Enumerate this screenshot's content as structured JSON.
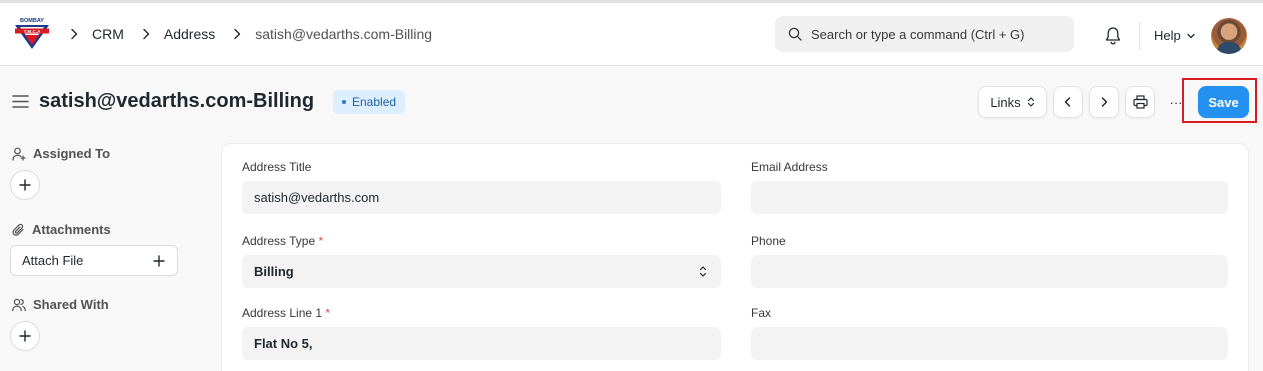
{
  "navbar": {
    "logo_text_top": "BOMBAY",
    "logo_text_bottom": "Y.M.C.A",
    "breadcrumbs": [
      "CRM",
      "Address",
      "satish@vedarths.com-Billing"
    ],
    "search_placeholder": "Search or type a command (Ctrl + G)",
    "help_label": "Help"
  },
  "header": {
    "title": "satish@vedarths.com-Billing",
    "status": "Enabled",
    "links_label": "Links",
    "more_label": "···",
    "save_label": "Save"
  },
  "sidebar": {
    "assigned_to": "Assigned To",
    "attachments": "Attachments",
    "attach_file": "Attach File",
    "shared_with": "Shared With"
  },
  "form": {
    "address_title": {
      "label": "Address Title",
      "value": "satish@vedarths.com"
    },
    "email_address": {
      "label": "Email Address",
      "value": ""
    },
    "address_type": {
      "label": "Address Type",
      "required": "*",
      "value": "Billing"
    },
    "phone": {
      "label": "Phone",
      "value": ""
    },
    "address_line_1": {
      "label": "Address Line 1",
      "required": "*",
      "value": "Flat No 5,"
    },
    "fax": {
      "label": "Fax",
      "value": ""
    }
  },
  "colors": {
    "primary": "#2490ef",
    "badge_bg": "#ddeeff",
    "badge_text": "#1f5fa6",
    "highlight": "#d81b22"
  }
}
